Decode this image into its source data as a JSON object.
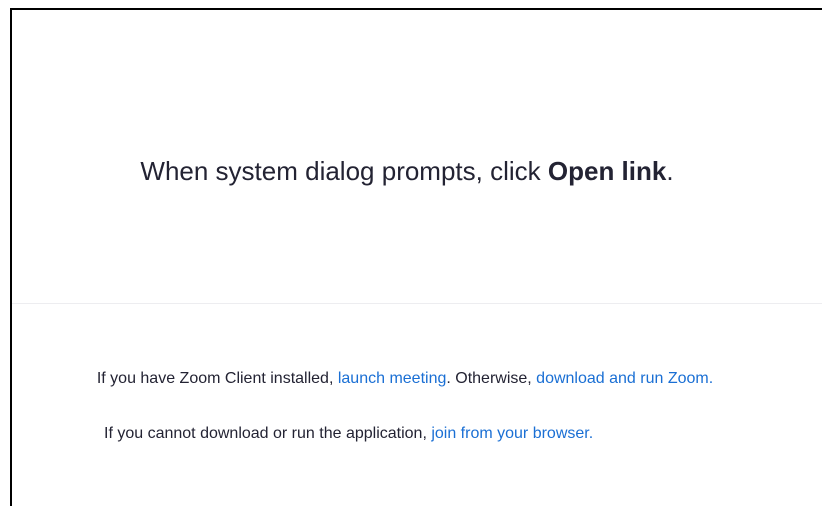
{
  "prompt": {
    "prefix": "When system dialog prompts, click ",
    "emphasis": "Open link",
    "suffix": "."
  },
  "launch_line": {
    "prefix": "If you have Zoom Client installed, ",
    "launch_link": "launch meeting",
    "middle": ". Otherwise, ",
    "download_link": "download and run Zoom."
  },
  "browser_line": {
    "prefix": "If you cannot download or run the application, ",
    "browser_link": "join from your browser."
  },
  "colors": {
    "link": "#1a6fd4",
    "text": "#232333",
    "divider": "#ededf0"
  }
}
